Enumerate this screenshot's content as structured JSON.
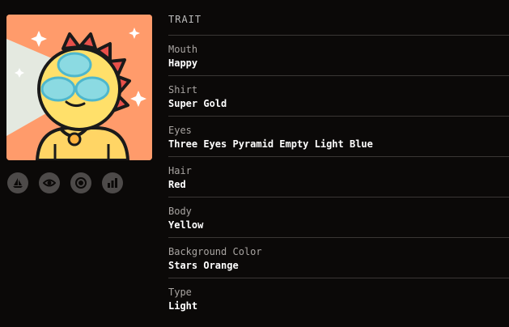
{
  "header": {
    "title": "TRAIT"
  },
  "traits": [
    {
      "label": "Mouth",
      "value": "Happy"
    },
    {
      "label": "Shirt",
      "value": "Super Gold"
    },
    {
      "label": "Eyes",
      "value": "Three Eyes Pyramid Empty Light Blue"
    },
    {
      "label": "Hair",
      "value": "Red"
    },
    {
      "label": "Body",
      "value": "Yellow"
    },
    {
      "label": "Background Color",
      "value": "Stars Orange"
    },
    {
      "label": "Type",
      "value": "Light"
    }
  ],
  "icons": [
    "sailboat-icon",
    "eye-icon",
    "circle-target-icon",
    "chart-icon"
  ],
  "colors": {
    "background": "#0b0908",
    "art_background": "#ff9b6b",
    "divider": "#3a3735",
    "icon_bg": "#4d4a49"
  }
}
